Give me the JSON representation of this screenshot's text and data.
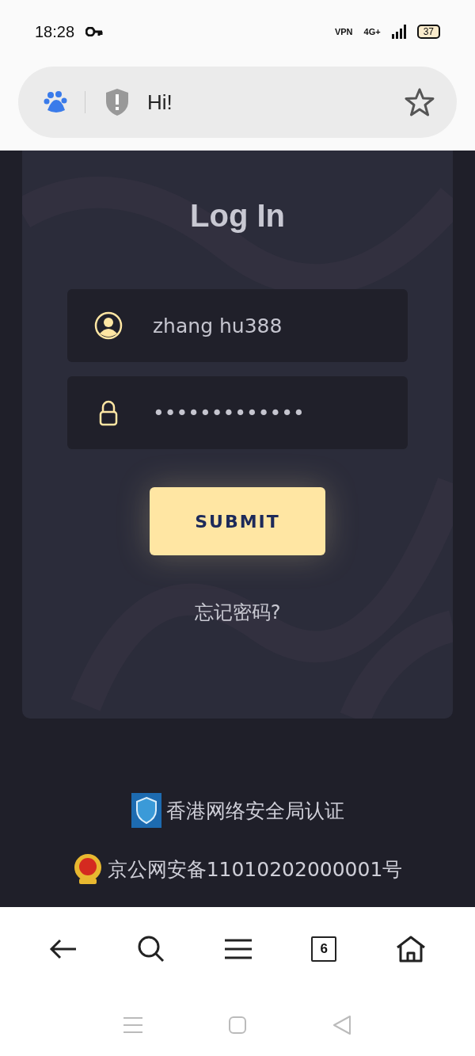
{
  "status_bar": {
    "time": "18:28",
    "vpn": "VPN",
    "network": "4G+",
    "battery": "37"
  },
  "address_bar": {
    "title": "Hi!"
  },
  "login": {
    "title": "Log In",
    "fields": [
      {
        "kind": "user",
        "value": "zhang hu388"
      },
      {
        "kind": "password",
        "value": "•••••••••••••"
      }
    ],
    "submit": "SUBMIT",
    "forgot": "忘记密码?"
  },
  "footer": [
    {
      "kind": "shield",
      "text": "香港网络安全局认证"
    },
    {
      "kind": "emblem",
      "text": "京公网安备11010202000001号"
    }
  ],
  "browser_nav": {
    "tabs_count": "6"
  }
}
